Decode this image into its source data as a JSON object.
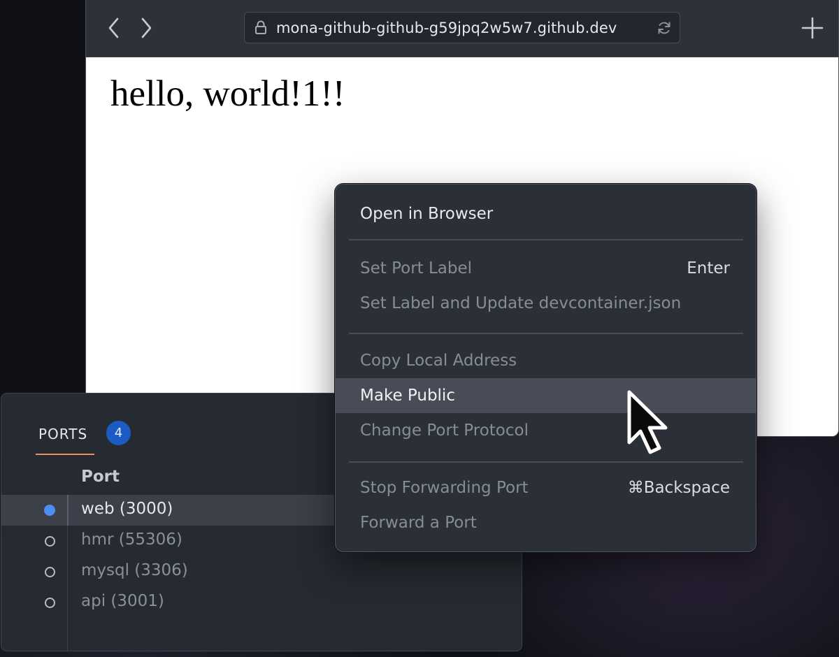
{
  "browser": {
    "url": "mona-github-github-g59jpq2w5w7.github.dev",
    "icons": {
      "back": "chevron-left-icon",
      "forward": "chevron-right-icon",
      "lock": "lock-icon",
      "reload": "reload-icon",
      "new_tab": "plus-icon"
    },
    "page": {
      "heading": "hello, world!1!!"
    }
  },
  "ports_panel": {
    "tab_label": "PORTS",
    "count": "4",
    "column_header": "Port",
    "rows": [
      {
        "label": "web (3000)",
        "active": true,
        "selected": true
      },
      {
        "label": "hmr (55306)",
        "active": false,
        "selected": false
      },
      {
        "label": "mysql (3306)",
        "active": false,
        "selected": false
      },
      {
        "label": "api (3001)",
        "active": false,
        "selected": false
      }
    ]
  },
  "context_menu": {
    "open_in_browser": "Open in Browser",
    "set_port_label": "Set Port Label",
    "set_port_label_shortcut": "Enter",
    "set_label_update": "Set Label and Update devcontainer.json",
    "copy_local_address": "Copy Local Address",
    "make_public": "Make Public",
    "change_port_protocol": "Change Port Protocol",
    "stop_forwarding_port": "Stop Forwarding Port",
    "stop_forwarding_shortcut": "⌘Backspace",
    "forward_a_port": "Forward a Port"
  },
  "colors": {
    "accent_tab_underline": "#e8915e",
    "badge_blue": "#1d5bc4",
    "active_dot": "#4b8ff4",
    "menu_background": "#2b2f37",
    "menu_highlight": "#474c56"
  }
}
